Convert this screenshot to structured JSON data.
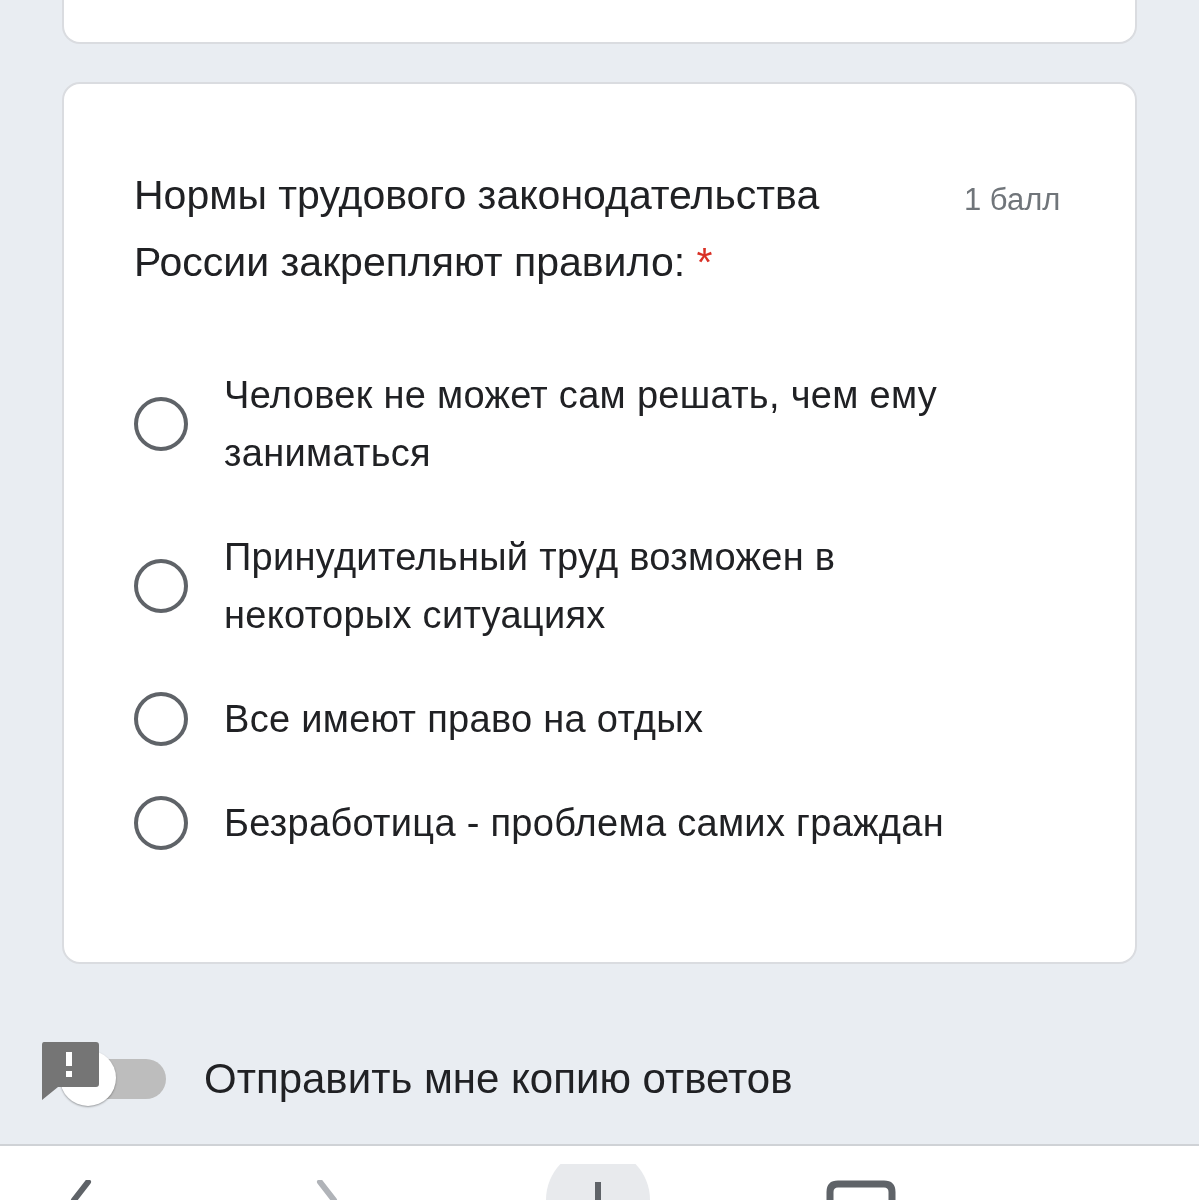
{
  "question": {
    "title": "Нормы трудового законодательства России закрепляют правило:",
    "points": "1 балл",
    "required_mark": "*"
  },
  "options": [
    {
      "label": "Человек не может сам решать, чем ему заниматься",
      "selected": false
    },
    {
      "label": "Принудительный труд возможен в некоторых ситуациях",
      "selected": false
    },
    {
      "label": "Все имеют право на отдых",
      "selected": false
    },
    {
      "label": "Безработица - проблема самих граждан",
      "selected": false
    }
  ],
  "send_copy": {
    "label": "Отправить мне копию ответов",
    "on": false
  }
}
